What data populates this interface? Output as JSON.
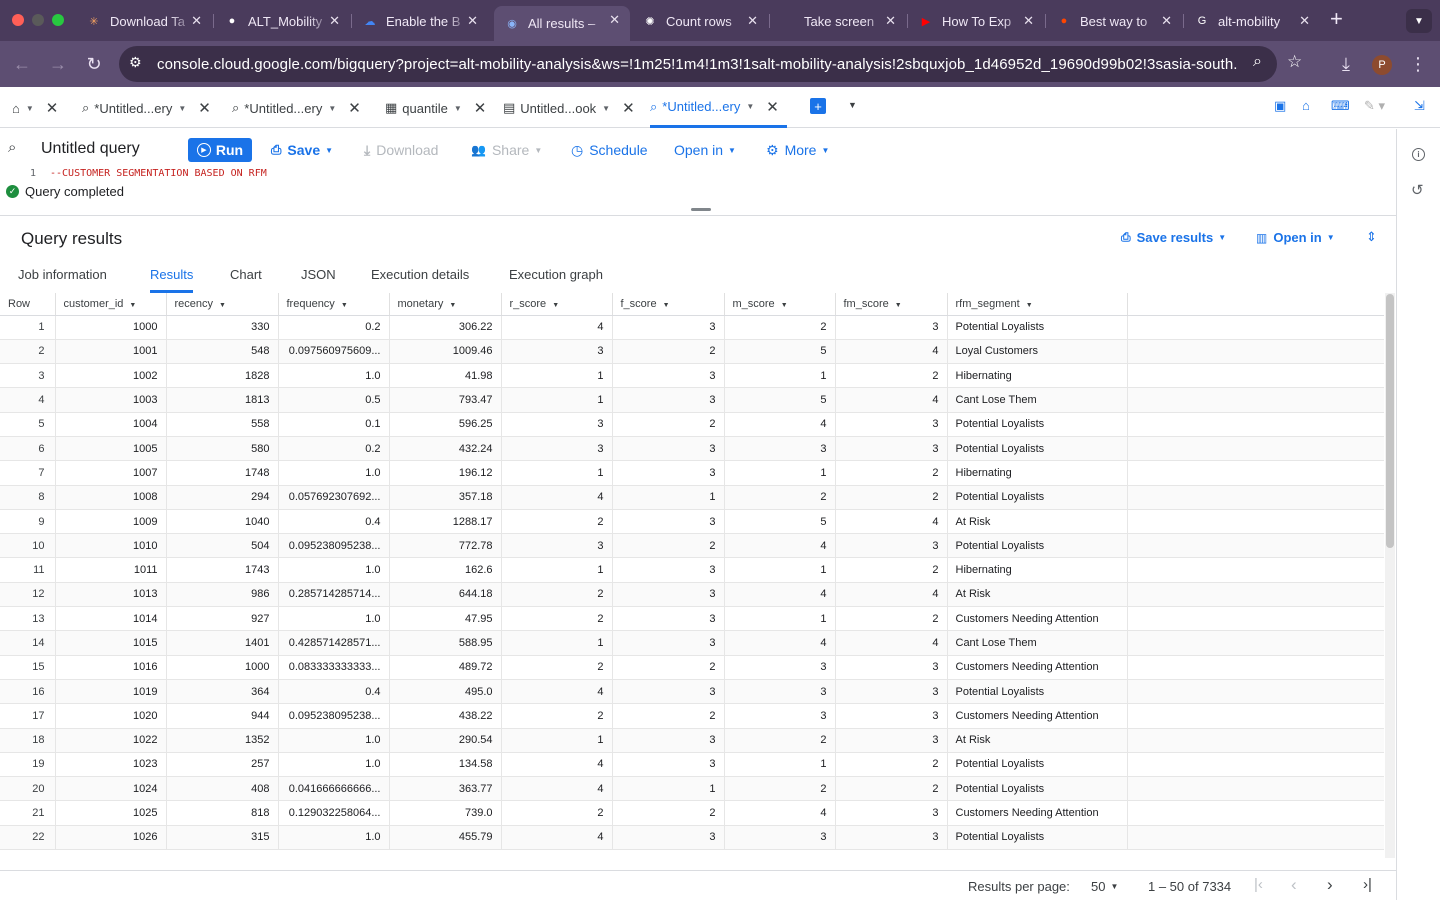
{
  "browser": {
    "tabs": [
      {
        "title": "Download Ta",
        "icon": "asterisk-app-icon",
        "color": "#f4a261",
        "glyph": "✳"
      },
      {
        "title": "ALT_Mobility",
        "icon": "github-icon",
        "color": "#ffffff",
        "glyph": "●"
      },
      {
        "title": "Enable the B",
        "icon": "google-cloud-icon",
        "color": "#4285f4",
        "glyph": "☁"
      },
      {
        "title": "All results –",
        "icon": "bigquery-icon",
        "color": "#8ab4f8",
        "glyph": "◉"
      },
      {
        "title": "Count rows",
        "icon": "openai-icon",
        "color": "#ffffff",
        "glyph": "✺"
      },
      {
        "title": "Take screen",
        "icon": "apple-icon",
        "color": "#e6e6e6",
        "glyph": ""
      },
      {
        "title": "How To Exp",
        "icon": "youtube-icon",
        "color": "#ff0000",
        "glyph": "▶"
      },
      {
        "title": "Best way to",
        "icon": "reddit-icon",
        "color": "#ff4500",
        "glyph": "●"
      },
      {
        "title": "alt-mobility",
        "icon": "google-icon",
        "color": "#ffffff",
        "glyph": "G"
      }
    ],
    "url": "console.cloud.google.com/bigquery?project=alt-mobility-analysis&ws=!1m25!1m4!1m3!1salt-mobility-analysis!2sbquxjob_1d46952d_19690d99b02!3sasia-south...",
    "profile_initial": "P"
  },
  "console_tabs": [
    {
      "label": "*Untitled...ery",
      "icon": "query-icon",
      "active": false
    },
    {
      "label": "*Untitled...ery",
      "icon": "query-icon",
      "active": false
    },
    {
      "label": "quantile",
      "icon": "table-icon",
      "active": false
    },
    {
      "label": "Untitled...ook",
      "icon": "notebook-icon",
      "active": false
    },
    {
      "label": "*Untitled...ery",
      "icon": "query-icon",
      "active": true
    }
  ],
  "query_toolbar": {
    "title": "Untitled query",
    "run": "Run",
    "save": "Save",
    "download": "Download",
    "share": "Share",
    "schedule": "Schedule",
    "open_in": "Open in",
    "more": "More"
  },
  "editor": {
    "line_number": "1",
    "code": "--CUSTOMER SEGMENTATION BASED ON RFM",
    "status": "Query completed"
  },
  "results": {
    "title": "Query results",
    "save_results": "Save results",
    "open_in": "Open in",
    "tabs": [
      "Job information",
      "Results",
      "Chart",
      "JSON",
      "Execution details",
      "Execution graph"
    ],
    "active_tab": "Results",
    "columns": [
      "Row",
      "customer_id",
      "recency",
      "frequency",
      "monetary",
      "r_score",
      "f_score",
      "m_score",
      "fm_score",
      "rfm_segment"
    ],
    "rows": [
      [
        "1",
        "1000",
        "330",
        "0.2",
        "306.22",
        "4",
        "3",
        "2",
        "3",
        "Potential Loyalists"
      ],
      [
        "2",
        "1001",
        "548",
        "0.097560975609...",
        "1009.46",
        "3",
        "2",
        "5",
        "4",
        "Loyal Customers"
      ],
      [
        "3",
        "1002",
        "1828",
        "1.0",
        "41.98",
        "1",
        "3",
        "1",
        "2",
        "Hibernating"
      ],
      [
        "4",
        "1003",
        "1813",
        "0.5",
        "793.47",
        "1",
        "3",
        "5",
        "4",
        "Cant Lose Them"
      ],
      [
        "5",
        "1004",
        "558",
        "0.1",
        "596.25",
        "3",
        "2",
        "4",
        "3",
        "Potential Loyalists"
      ],
      [
        "6",
        "1005",
        "580",
        "0.2",
        "432.24",
        "3",
        "3",
        "3",
        "3",
        "Potential Loyalists"
      ],
      [
        "7",
        "1007",
        "1748",
        "1.0",
        "196.12",
        "1",
        "3",
        "1",
        "2",
        "Hibernating"
      ],
      [
        "8",
        "1008",
        "294",
        "0.057692307692...",
        "357.18",
        "4",
        "1",
        "2",
        "2",
        "Potential Loyalists"
      ],
      [
        "9",
        "1009",
        "1040",
        "0.4",
        "1288.17",
        "2",
        "3",
        "5",
        "4",
        "At Risk"
      ],
      [
        "10",
        "1010",
        "504",
        "0.095238095238...",
        "772.78",
        "3",
        "2",
        "4",
        "3",
        "Potential Loyalists"
      ],
      [
        "11",
        "1011",
        "1743",
        "1.0",
        "162.6",
        "1",
        "3",
        "1",
        "2",
        "Hibernating"
      ],
      [
        "12",
        "1013",
        "986",
        "0.285714285714...",
        "644.18",
        "2",
        "3",
        "4",
        "4",
        "At Risk"
      ],
      [
        "13",
        "1014",
        "927",
        "1.0",
        "47.95",
        "2",
        "3",
        "1",
        "2",
        "Customers Needing Attention"
      ],
      [
        "14",
        "1015",
        "1401",
        "0.428571428571...",
        "588.95",
        "1",
        "3",
        "4",
        "4",
        "Cant Lose Them"
      ],
      [
        "15",
        "1016",
        "1000",
        "0.083333333333...",
        "489.72",
        "2",
        "2",
        "3",
        "3",
        "Customers Needing Attention"
      ],
      [
        "16",
        "1019",
        "364",
        "0.4",
        "495.0",
        "4",
        "3",
        "3",
        "3",
        "Potential Loyalists"
      ],
      [
        "17",
        "1020",
        "944",
        "0.095238095238...",
        "438.22",
        "2",
        "2",
        "3",
        "3",
        "Customers Needing Attention"
      ],
      [
        "18",
        "1022",
        "1352",
        "1.0",
        "290.54",
        "1",
        "3",
        "2",
        "3",
        "At Risk"
      ],
      [
        "19",
        "1023",
        "257",
        "1.0",
        "134.58",
        "4",
        "3",
        "1",
        "2",
        "Potential Loyalists"
      ],
      [
        "20",
        "1024",
        "408",
        "0.041666666666...",
        "363.77",
        "4",
        "1",
        "2",
        "2",
        "Potential Loyalists"
      ],
      [
        "21",
        "1025",
        "818",
        "0.129032258064...",
        "739.0",
        "2",
        "2",
        "4",
        "3",
        "Customers Needing Attention"
      ],
      [
        "22",
        "1026",
        "315",
        "1.0",
        "455.79",
        "4",
        "3",
        "3",
        "3",
        "Potential Loyalists"
      ]
    ],
    "footer": {
      "per_page_label": "Results per page:",
      "per_page_value": "50",
      "range": "1 – 50 of 7334"
    }
  }
}
